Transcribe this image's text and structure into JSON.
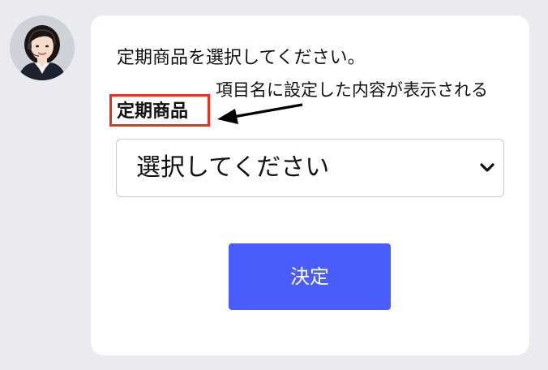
{
  "chat": {
    "prompt": "定期商品を選択してください。",
    "field_label": "定期商品",
    "select": {
      "selected_value": "選択してください"
    },
    "submit_label": "決定"
  },
  "annotation": {
    "text": "項目名に設定した内容が表示される"
  },
  "colors": {
    "background": "#ebebef",
    "card": "#ffffff",
    "button": "#4a5cfa",
    "highlight": "#e8321e"
  },
  "icons": {
    "select_arrow": "chevron-down-icon",
    "annotation_arrow": "arrow-left-icon",
    "avatar": "operator-avatar"
  }
}
